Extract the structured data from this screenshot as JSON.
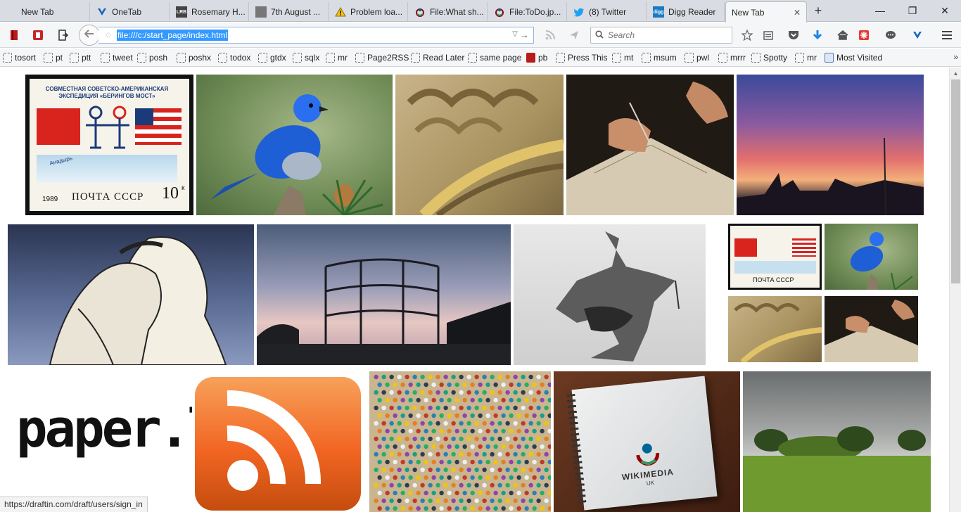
{
  "tabs": [
    {
      "label": "New Tab",
      "icon": "blank-page-icon"
    },
    {
      "label": "OneTab",
      "icon": "onetab-icon"
    },
    {
      "label": "Rosemary H...",
      "icon": "lrb-icon"
    },
    {
      "label": "7th August ...",
      "icon": "page-icon"
    },
    {
      "label": "Problem loa...",
      "icon": "warning-icon"
    },
    {
      "label": "File:What sh...",
      "icon": "wikimedia-icon"
    },
    {
      "label": "File:ToDo.jp...",
      "icon": "wikimedia-icon"
    },
    {
      "label": "(8) Twitter",
      "icon": "twitter-icon"
    },
    {
      "label": "Digg Reader",
      "icon": "digg-icon"
    },
    {
      "label": "New Tab",
      "icon": "blank-page-icon",
      "active": true
    }
  ],
  "tab_icon_text": {
    "lrb": "LRB",
    "digg": "digg"
  },
  "window": {
    "minimize": "—",
    "restore": "❐",
    "close": "✕",
    "new_tab": "+",
    "tab_close": "✕"
  },
  "navbar": {
    "url": "file:///c:/start_page/index.html",
    "search_placeholder": "Search"
  },
  "bookmarks": [
    "tosort",
    "pt",
    "ptt",
    "tweet",
    "posh",
    "poshx",
    "todox",
    "gtdx",
    "sqlx",
    "mr",
    "Page2RSS",
    "Read Later",
    "same page",
    "pb",
    "Press This",
    "mt",
    "msum",
    "pwl",
    "mrrr",
    "Spotty",
    "mr",
    "Most Visited"
  ],
  "bookmarks_more": "»",
  "status_url": "https://draftin.com/draft/users/sign_in",
  "tiles": {
    "stamp_header": "СОВМЕСТНАЯ СОВЕТСКО-АМЕРИКАНСКАЯ ЭКСПЕДИЦИЯ «БЕРИНГОВ МОСТ»",
    "stamp_year": "1989",
    "stamp_post": "ПОЧТА СССР",
    "stamp_value": "10",
    "stamp_kop": "к",
    "stamp_place": "Анадырь",
    "paperli": "paper.li",
    "wikimedia": "WIKIMEDIA",
    "wikimedia_sub": "UK"
  },
  "colors": {
    "accent": "#3399ff",
    "rss_orange": "#f26522",
    "tab_bg": "#d9dde3",
    "toolbar_bg": "#f5f6f7"
  }
}
